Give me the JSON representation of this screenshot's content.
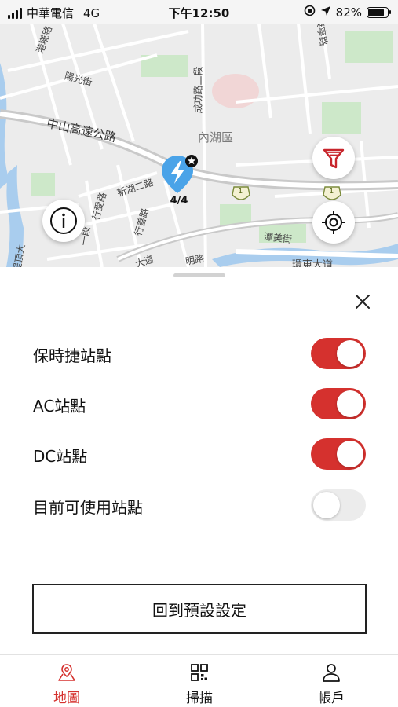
{
  "status_bar": {
    "carrier": "中華電信",
    "network": "4G",
    "time": "下午12:50",
    "battery": "82%",
    "battery_level": 0.82
  },
  "map": {
    "district_label": "內湖區",
    "streets": [
      "港墘路",
      "陽光街",
      "中山高速公路",
      "成功路二段",
      "新湖二路",
      "行善路",
      "行愛路",
      "堤頂大",
      "潭美街",
      "環東大道",
      "大道",
      "明路",
      "一段",
      "康寧路"
    ],
    "highway_shields": [
      "1",
      "1"
    ],
    "station_marker": {
      "count": "4/4",
      "icon": "lightning-pin-icon"
    },
    "buttons": {
      "info_icon": "info-icon",
      "filter_icon": "filter-funnel-icon",
      "locate_icon": "crosshair-locate-icon"
    },
    "colors": {
      "marker": "#4aa3e8",
      "filter": "#c8252c",
      "water": "#a9cdee",
      "park": "#cde8c9"
    }
  },
  "filter_sheet": {
    "close_icon": "close-icon",
    "options": [
      {
        "label": "保時捷站點",
        "enabled": true
      },
      {
        "label": "AC站點",
        "enabled": true
      },
      {
        "label": "DC站點",
        "enabled": true
      },
      {
        "label": "目前可使用站點",
        "enabled": false
      }
    ],
    "reset_label": "回到預設設定",
    "colors": {
      "toggle_on": "#d5312e",
      "toggle_off": "#ececec"
    }
  },
  "tabbar": {
    "tabs": [
      {
        "label": "地圖",
        "icon": "map-pin-icon",
        "active": true
      },
      {
        "label": "掃描",
        "icon": "qr-scan-icon",
        "active": false
      },
      {
        "label": "帳戶",
        "icon": "user-icon",
        "active": false
      }
    ],
    "active_color": "#d5312e"
  }
}
